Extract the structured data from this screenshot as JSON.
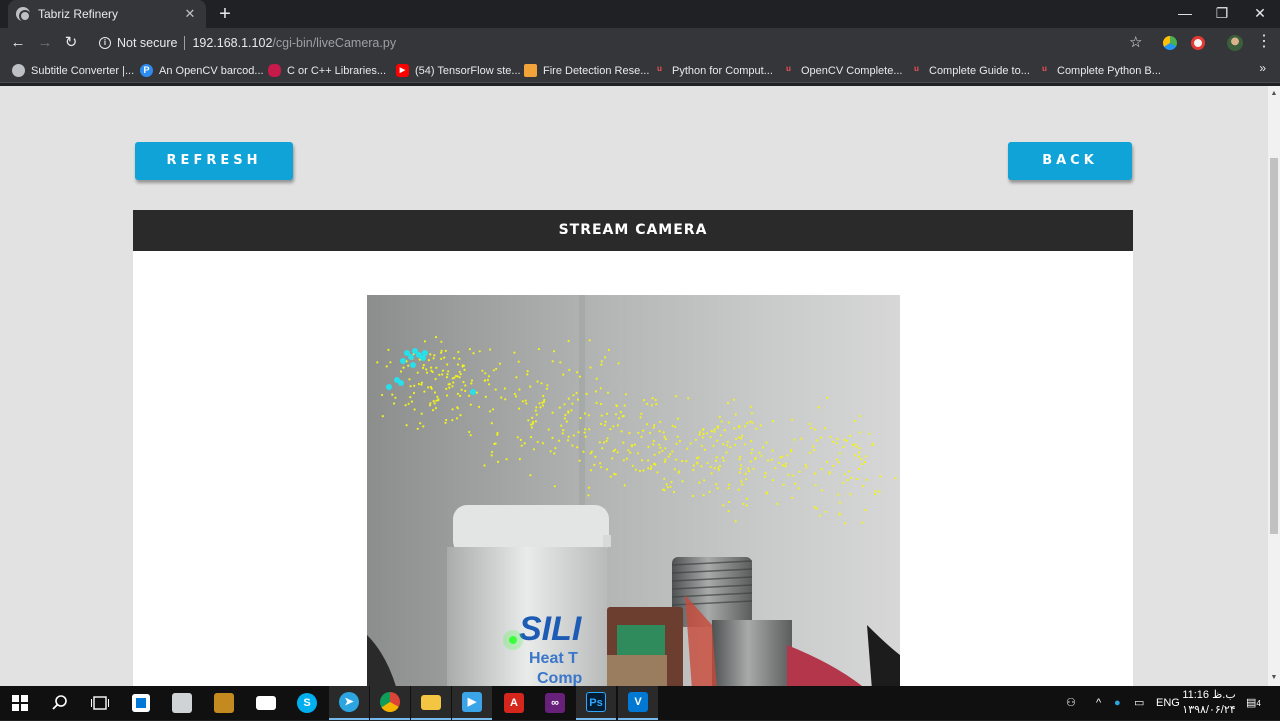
{
  "browser": {
    "tab_title": "Tabriz Refinery",
    "tab_close": "✕",
    "new_tab": "+",
    "window_controls": {
      "minimize": "—",
      "maximize": "❐",
      "close": "✕"
    },
    "nav": {
      "back": "←",
      "forward": "→",
      "reload": "↻"
    },
    "security_label": "Not secure",
    "url_host": "192.168.1.102",
    "url_path": "/cgi-bin/liveCamera.py",
    "bookmark_star": "☆",
    "menu": "⋮",
    "bookmarks": [
      {
        "label": "Subtitle Converter |...",
        "icon": "globe-icon",
        "color": "#bdc1c6"
      },
      {
        "label": "An OpenCV barcod...",
        "icon": "p-icon",
        "color": "#2d8cf0"
      },
      {
        "label": "C or C++ Libraries...",
        "icon": "raspberry-icon",
        "color": "#c51a4a"
      },
      {
        "label": "(54) TensorFlow ste...",
        "icon": "youtube-icon",
        "color": "#ff0000"
      },
      {
        "label": "Fire Detection Rese...",
        "icon": "fire-icon",
        "color": "#f2a33a"
      },
      {
        "label": "Python for Comput...",
        "icon": "udemy-icon",
        "color": "#ec5252"
      },
      {
        "label": "OpenCV Complete...",
        "icon": "udemy-icon",
        "color": "#ec5252"
      },
      {
        "label": "Complete Guide to...",
        "icon": "udemy-icon",
        "color": "#ec5252"
      },
      {
        "label": "Complete Python B...",
        "icon": "udemy-icon",
        "color": "#ec5252"
      }
    ],
    "bookmarks_more": "»"
  },
  "page": {
    "refresh_label": "REFRESH",
    "back_label": "BACK",
    "panel_title": "STREAM CAMERA",
    "accent_color": "#0fa3d8"
  },
  "taskbar": {
    "apps": [
      "start-icon",
      "search-icon",
      "task-view-icon",
      "store-icon",
      "file-icon",
      "mail-icon",
      "skype-icon",
      "telegram-icon",
      "chrome-icon",
      "explorer-icon",
      "media-icon",
      "acrobat-icon",
      "visual-studio-icon",
      "photoshop-icon",
      "vs-code-icon"
    ],
    "language": "ENG",
    "time": "11:16 ب.ظ",
    "date": "۱۳۹۸/۰۶/۲۴",
    "notifications": "4"
  }
}
